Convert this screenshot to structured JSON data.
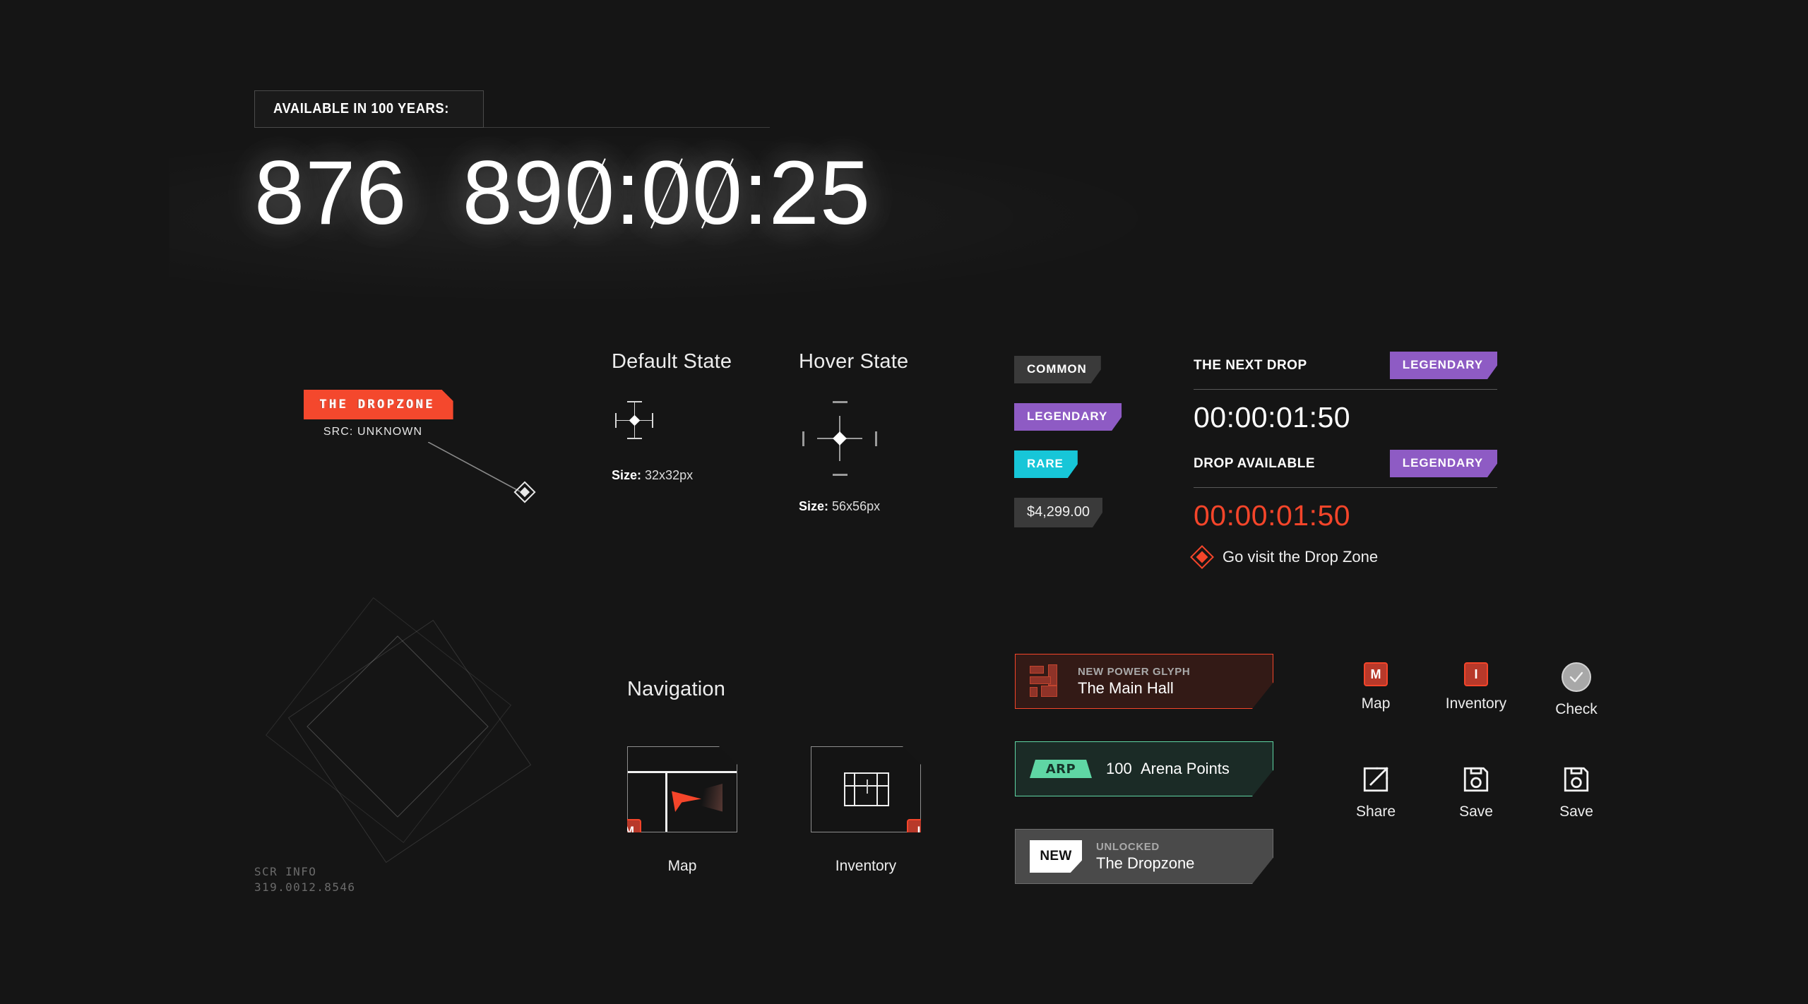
{
  "hero": {
    "label": "AVAILABLE IN 100 YEARS:",
    "days": "876",
    "hours": "890",
    "minutes": "00",
    "seconds": "25",
    "separator": ":"
  },
  "pin": {
    "flag_label": "THE DR⁠OPZONE",
    "source": "SRC: UNKNOWN",
    "marker_icon": "diamond-marker-icon"
  },
  "reticles": {
    "default": {
      "title": "Default State",
      "size_label": "Size:",
      "size_value": "32x32px",
      "icon": "crosshair-reticle-icon"
    },
    "hover": {
      "title": "Hover State",
      "size_label": "Size:",
      "size_value": "56x56px",
      "icon": "crosshair-reticle-expanded-icon"
    }
  },
  "rarity_badges": [
    {
      "label": "COMMON",
      "variant": "common",
      "color": "#3a3a3a"
    },
    {
      "label": "LEGENDARY",
      "variant": "legendary",
      "color": "#8e5bc4"
    },
    {
      "label": "RARE",
      "variant": "rare",
      "color": "#17c6d8"
    }
  ],
  "price_chip": {
    "value": "$4,299.00"
  },
  "drop_panel": {
    "next_drop_label": "THE NEXT DROP",
    "next_drop_rarity": "LEGENDARY",
    "next_drop_timer": "00:00:01:50",
    "available_label": "DROP AVAILABLE",
    "available_rarity": "LEGENDARY",
    "available_timer": "00:00:01:50",
    "cta_text": "Go visit the Drop Zone",
    "cta_icon": "red-diamond-icon",
    "alert_color": "#f4452a"
  },
  "navigation": {
    "title": "Navigation",
    "cards": [
      {
        "caption": "Map",
        "key": "M",
        "key_position": "bottom-left",
        "icon": "map-thumbnail-icon"
      },
      {
        "caption": "Inventory",
        "key": "I",
        "key_position": "bottom-right",
        "icon": "inventory-thumbnail-icon"
      }
    ]
  },
  "decoration": {
    "scr_info_label": "SCR INFO",
    "scr_info_value": "319.0012.8546"
  },
  "toasts": [
    {
      "kicker": "NEW POWER GLYPH",
      "title": "The Main Hall",
      "variant": "glyph",
      "icon": "power-glyph-icon",
      "accent": "#f4452a"
    },
    {
      "kicker": "",
      "title": "Arena Points",
      "variant": "points",
      "icon": "arp-badge-icon",
      "accent": "#5fd6a4",
      "badge_text": "ARP",
      "amount": "100"
    },
    {
      "kicker": "UNLOCKED",
      "title": "The Dropzone",
      "variant": "unlock",
      "icon": "new-tag-icon",
      "accent": "#6e6e6e",
      "tag_text": "NEW"
    }
  ],
  "icon_buttons": {
    "row1": [
      {
        "caption": "Map",
        "key": "M",
        "icon": "keycap-m-icon"
      },
      {
        "caption": "Inventory",
        "key": "I",
        "icon": "keycap-i-icon"
      },
      {
        "caption": "Check",
        "key": "",
        "icon": "check-circle-icon"
      }
    ],
    "row2": [
      {
        "caption": "Share",
        "icon": "share-external-link-icon"
      },
      {
        "caption": "Save",
        "icon": "floppy-disk-icon"
      },
      {
        "caption": "Save",
        "icon": "floppy-disk-icon"
      }
    ]
  }
}
